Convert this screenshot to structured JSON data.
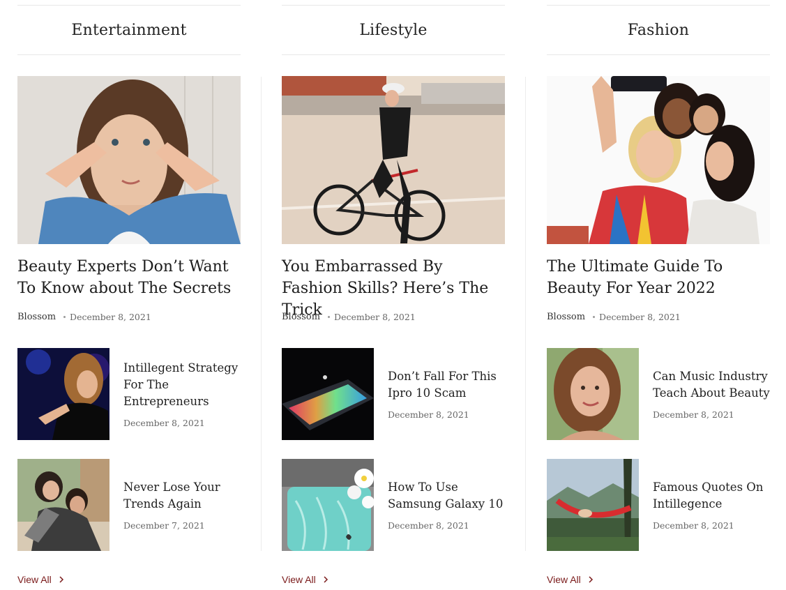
{
  "columns": [
    {
      "category": "Entertainment",
      "featured": {
        "image_icon": "woman-peace-sign-photo",
        "title": "Beauty Experts Don’t Want To Know about The Secrets",
        "author": "Blossom",
        "date": "December 8, 2021"
      },
      "items": [
        {
          "image_icon": "singer-on-stage-photo",
          "title": "Intillegent Strategy For The Entrepreneurs",
          "date": "December 8, 2021"
        },
        {
          "image_icon": "couple-piggyback-photo",
          "title": "Never Lose Your Trends Again",
          "date": "December 7, 2021"
        }
      ],
      "view_all": "View All"
    },
    {
      "category": "Lifestyle",
      "featured": {
        "image_icon": "cyclist-photo",
        "title": "You Embarrassed By Fashion Skills? Here’s The Trick",
        "author": "Blossom",
        "date": "December 8, 2021"
      },
      "items": [
        {
          "image_icon": "laptop-rgb-photo",
          "title": "Don’t Fall For This Ipro 10 Scam",
          "date": "December 8, 2021"
        },
        {
          "image_icon": "phone-flowers-photo",
          "title": "How To Use Samsung Galaxy 10",
          "date": "December 8, 2021"
        }
      ],
      "view_all": "View All"
    },
    {
      "category": "Fashion",
      "featured": {
        "image_icon": "friends-selfie-photo",
        "title": "The Ultimate Guide To Beauty For Year 2022",
        "author": "Blossom",
        "date": "December 8, 2021"
      },
      "items": [
        {
          "image_icon": "smiling-woman-portrait-photo",
          "title": "Can Music Industry Teach About Beauty",
          "date": "December 8, 2021"
        },
        {
          "image_icon": "hammock-forest-photo",
          "title": "Famous Quotes On Intillegence",
          "date": "December 8, 2021"
        }
      ],
      "view_all": "View All"
    }
  ],
  "colors": {
    "accent": "#7a1a1a",
    "divider": "#e8e8e8",
    "meta_text": "#666666"
  }
}
